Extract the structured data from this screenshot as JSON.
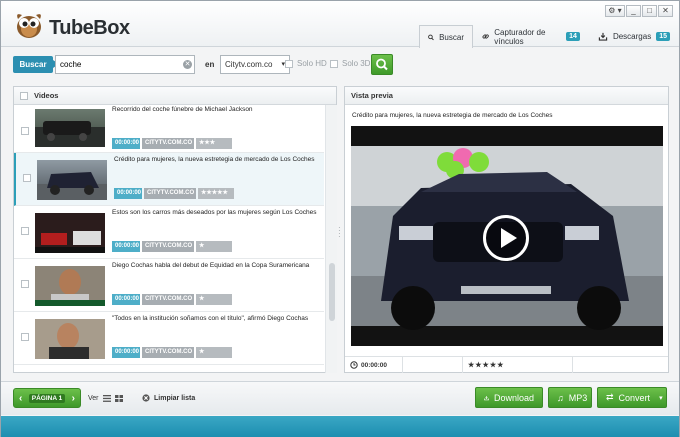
{
  "app": {
    "title": "TubeBox"
  },
  "window_buttons": [
    "⚙ ▾",
    "_",
    "□",
    "✕"
  ],
  "tabs": [
    {
      "label": "Buscar",
      "badge": ""
    },
    {
      "label": "Capturador de vínculos",
      "badge": "14"
    },
    {
      "label": "Descargas",
      "badge": "15"
    }
  ],
  "search": {
    "button_label": "Buscar",
    "query": "coche",
    "en_label": "en",
    "site": "Citytv.com.co",
    "solo_hd": "Solo HD",
    "solo_3d": "Solo 3D"
  },
  "videos_panel": {
    "header": "Videos",
    "items": [
      {
        "title": "Recorrido del coche fúnebre de Michael Jackson",
        "duration": "00:00:00",
        "source": "CITYTV.COM.CO",
        "stars": "★★★",
        "selected": false
      },
      {
        "title": "Crédito para mujeres, la nueva estretegia de mercado de Los Coches",
        "duration": "00:00:00",
        "source": "CITYTV.COM.CO",
        "stars": "★★★★★",
        "selected": true
      },
      {
        "title": "Estos son los carros más deseados por las mujeres según Los Coches",
        "duration": "00:00:00",
        "source": "CITYTV.COM.CO",
        "stars": "★",
        "selected": false
      },
      {
        "title": "Diego Cochas habla del debut de Equidad en la Copa Suramericana",
        "duration": "00:00:00",
        "source": "CITYTV.COM.CO",
        "stars": "★",
        "selected": false
      },
      {
        "title": "\"Todos en la institución soñamos con el título\", afirmó Diego Cochas",
        "duration": "00:00:00",
        "source": "CITYTV.COM.CO",
        "stars": "★",
        "selected": false
      }
    ]
  },
  "preview_panel": {
    "header": "Vista previa",
    "title": "Crédito para mujeres, la nueva estretegia de mercado de Los Coches",
    "time": "00:00:00",
    "stars": "★★★★★"
  },
  "bottom": {
    "page_label": "PÁGINA 1",
    "ver_label": "Ver",
    "limpiar": "Limpiar lista",
    "download": "Download",
    "mp3": "MP3",
    "convert": "Convert"
  },
  "colors": {
    "accent": "#2c9fb8",
    "green": "#4caf32"
  }
}
